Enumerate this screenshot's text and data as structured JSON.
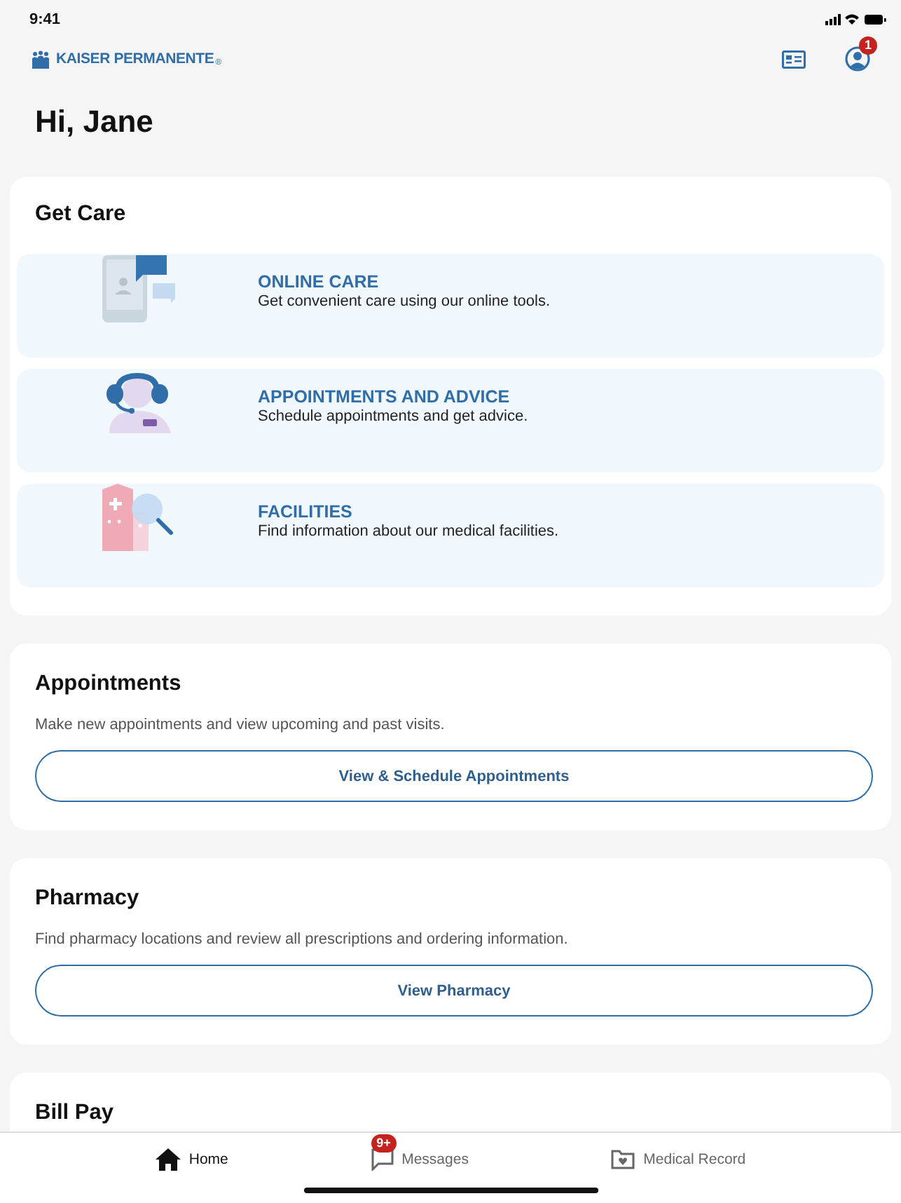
{
  "status_bar": {
    "time": "9:41"
  },
  "header": {
    "logo": "KAISER PERMANENTE",
    "logo_mark": "®",
    "profile_badge": "1"
  },
  "greeting": "Hi, Jane",
  "get_care": {
    "title": "Get Care",
    "items": [
      {
        "kind": "online",
        "title": "ONLINE CARE",
        "description": "Get convenient care using our online tools."
      },
      {
        "kind": "advice",
        "title": "APPOINTMENTS AND ADVICE",
        "description": "Schedule appointments and get advice."
      },
      {
        "kind": "facilities",
        "title": "FACILITIES",
        "description": "Find information about our medical facilities."
      }
    ]
  },
  "sections": [
    {
      "title": "Appointments",
      "description": "Make new appointments and view upcoming and past visits.",
      "button": "View & Schedule Appointments"
    },
    {
      "title": "Pharmacy",
      "description": "Find pharmacy locations and review all prescriptions and ordering information.",
      "button": "View Pharmacy"
    },
    {
      "title": "Bill Pay"
    }
  ],
  "tab_bar": [
    {
      "kind": "home",
      "label": "Home",
      "selected": true
    },
    {
      "kind": "messages",
      "label": "Messages",
      "badge": "9+",
      "selected": false
    },
    {
      "kind": "record",
      "label": "Medical Record",
      "selected": false
    }
  ]
}
